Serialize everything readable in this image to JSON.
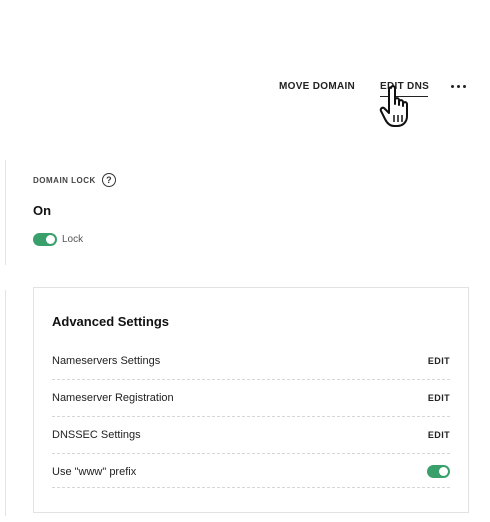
{
  "header_actions": {
    "move_domain": "MOVE DOMAIN",
    "edit_dns": "EDIT DNS",
    "more_icon": "ellipsis-icon"
  },
  "domain_lock": {
    "label": "DOMAIN LOCK",
    "help_icon": "question-circle-icon",
    "help_glyph": "?",
    "status": "On",
    "toggle_label": "Lock",
    "toggle_on": true
  },
  "advanced_settings": {
    "title": "Advanced Settings",
    "rows": [
      {
        "label": "Nameservers Settings",
        "action": "EDIT"
      },
      {
        "label": "Nameserver Registration",
        "action": "EDIT"
      },
      {
        "label": "DNSSEC Settings",
        "action": "EDIT"
      },
      {
        "label": "Use \"www\" prefix",
        "toggle_on": true
      }
    ]
  },
  "colors": {
    "toggle_on": "#3aa06b",
    "text": "#1b1b1b",
    "border": "#e2e2e2"
  }
}
